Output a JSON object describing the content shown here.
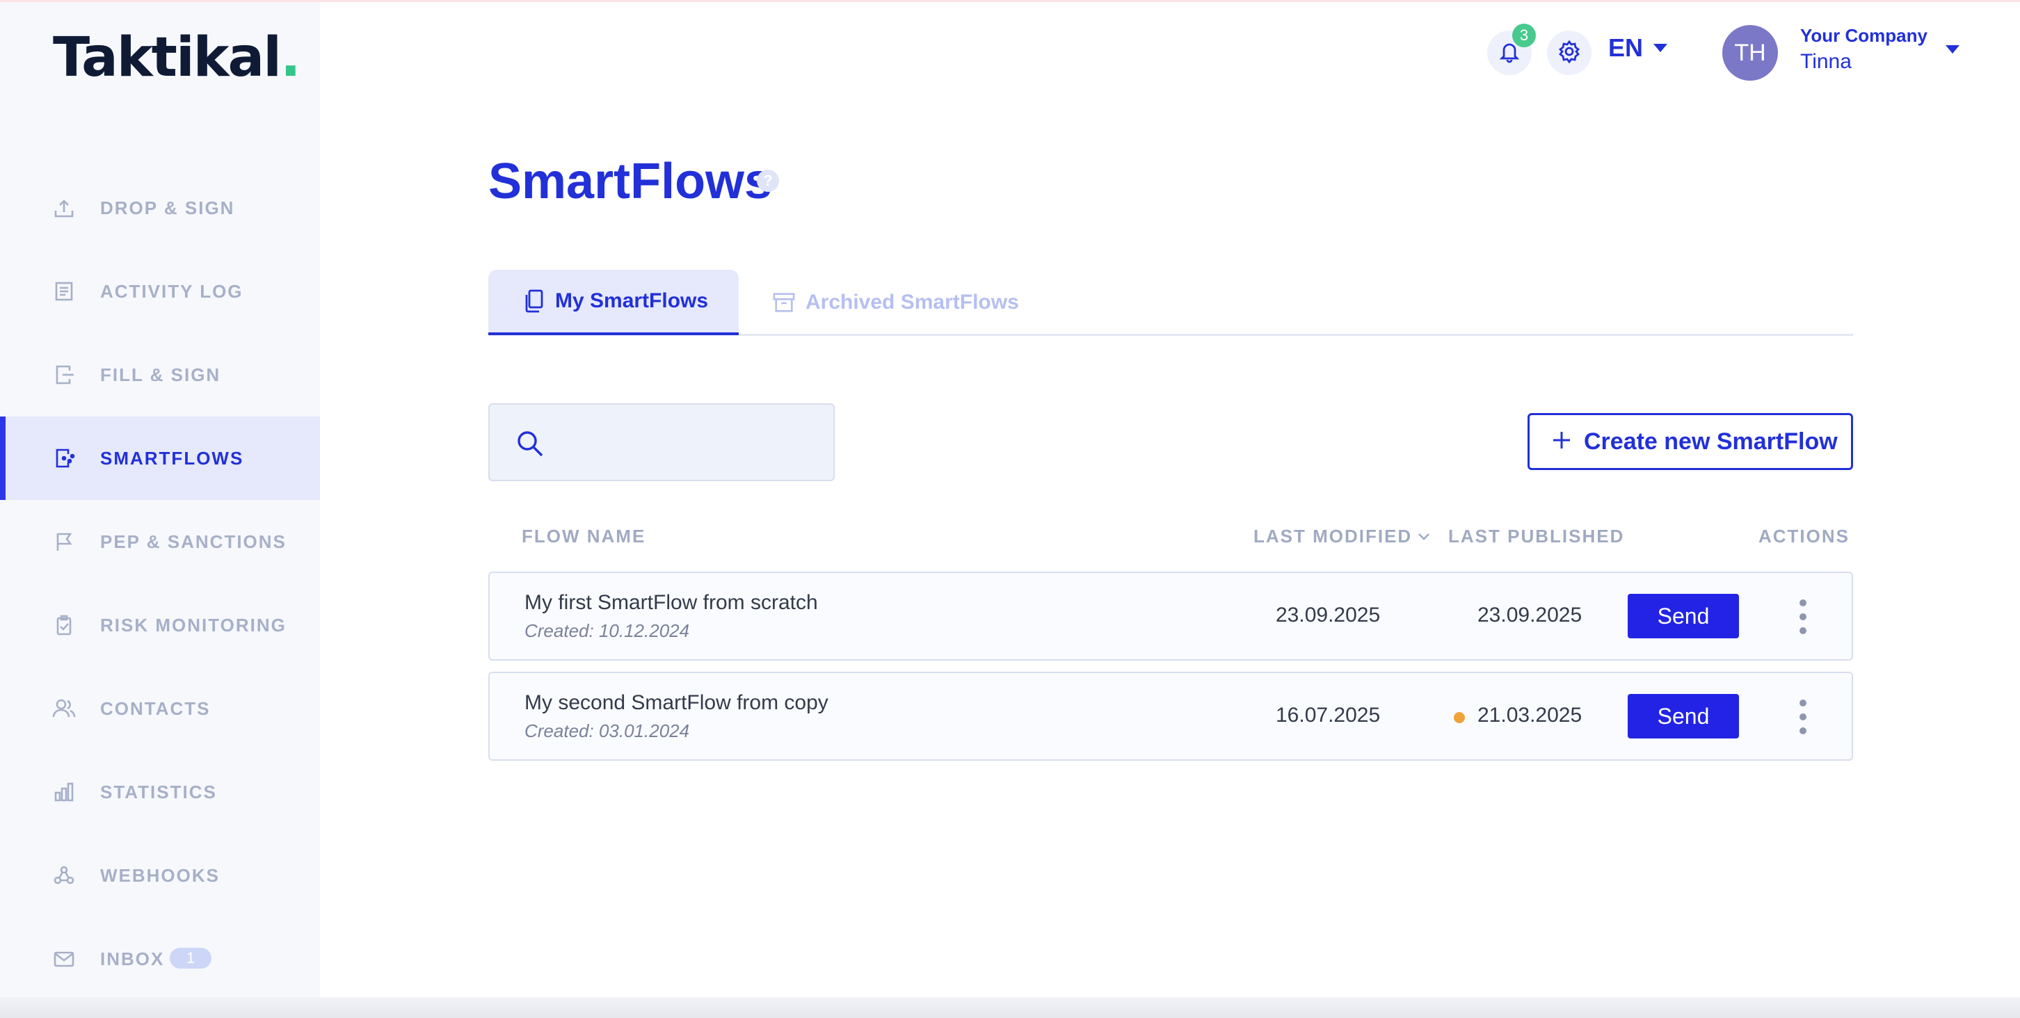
{
  "brand": {
    "name": "Taktikal",
    "dot": ".",
    "dot_color": "#34c58a"
  },
  "colors": {
    "accent": "#2230d8",
    "send_button": "#2323e5",
    "pending_dot": "#f0a23a",
    "badge_green": "#48c98d"
  },
  "sidebar": {
    "items": [
      {
        "label": "DROP & SIGN",
        "icon": "upload-icon"
      },
      {
        "label": "ACTIVITY LOG",
        "icon": "document-list-icon"
      },
      {
        "label": "FILL & SIGN",
        "icon": "document-edit-icon"
      },
      {
        "label": "SMARTFLOWS",
        "icon": "smartflow-document-icon",
        "active": true
      },
      {
        "label": "PEP & SANCTIONS",
        "icon": "flag-icon"
      },
      {
        "label": "RISK MONITORING",
        "icon": "clipboard-check-icon"
      },
      {
        "label": "CONTACTS",
        "icon": "users-icon"
      },
      {
        "label": "STATISTICS",
        "icon": "bar-chart-icon"
      },
      {
        "label": "WEBHOOKS",
        "icon": "webhook-icon"
      },
      {
        "label": "INBOX",
        "icon": "mail-icon",
        "badge": "1"
      }
    ]
  },
  "header": {
    "notifications_count": "3",
    "language": "EN",
    "avatar_initials": "TH",
    "company": "Your Company",
    "user": "Tinna"
  },
  "main": {
    "title": "SmartFlows",
    "help": "?",
    "tabs": [
      {
        "label": "My SmartFlows",
        "active": true
      },
      {
        "label": "Archived SmartFlows",
        "active": false
      }
    ],
    "search": {
      "placeholder": "",
      "value": ""
    },
    "create_button": "Create new SmartFlow",
    "table": {
      "columns": {
        "flow_name": "FLOW NAME",
        "last_modified": "LAST MODIFIED",
        "last_published": "LAST PUBLISHED",
        "actions": "ACTIONS"
      },
      "rows": [
        {
          "name": "My first SmartFlow from scratch",
          "created": "Created: 10.12.2024",
          "last_modified": "23.09.2025",
          "last_published": "23.09.2025",
          "action": "Send",
          "pending": false
        },
        {
          "name": "My second SmartFlow from copy",
          "created": "Created: 03.01.2024",
          "last_modified": "16.07.2025",
          "last_published": "21.03.2025",
          "action": "Send",
          "pending": true
        }
      ]
    }
  }
}
